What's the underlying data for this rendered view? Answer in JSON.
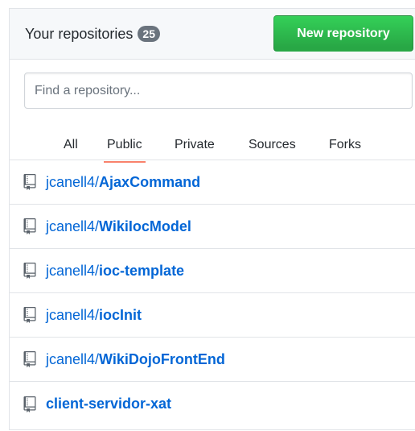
{
  "header": {
    "title": "Your repositories",
    "count": "25",
    "new_button_label": "New repository"
  },
  "search": {
    "placeholder": "Find a repository...",
    "value": ""
  },
  "tabs": [
    {
      "label": "All",
      "active": false
    },
    {
      "label": "Public",
      "active": true
    },
    {
      "label": "Private",
      "active": false
    },
    {
      "label": "Sources",
      "active": false
    },
    {
      "label": "Forks",
      "active": false
    }
  ],
  "repos": [
    {
      "owner": "jcanell4/",
      "name": "AjaxCommand"
    },
    {
      "owner": "jcanell4/",
      "name": "WikiIocModel"
    },
    {
      "owner": "jcanell4/",
      "name": "ioc-template"
    },
    {
      "owner": "jcanell4/",
      "name": "iocInit"
    },
    {
      "owner": "jcanell4/",
      "name": "WikiDojoFrontEnd"
    },
    {
      "owner": "",
      "name": "client-servidor-xat"
    }
  ],
  "colors": {
    "link": "#0366d6",
    "accent_underline": "#f9826c",
    "button_green": "#28a745",
    "counter_bg": "#6a737d"
  },
  "icons": {
    "repo": "repo-icon"
  }
}
